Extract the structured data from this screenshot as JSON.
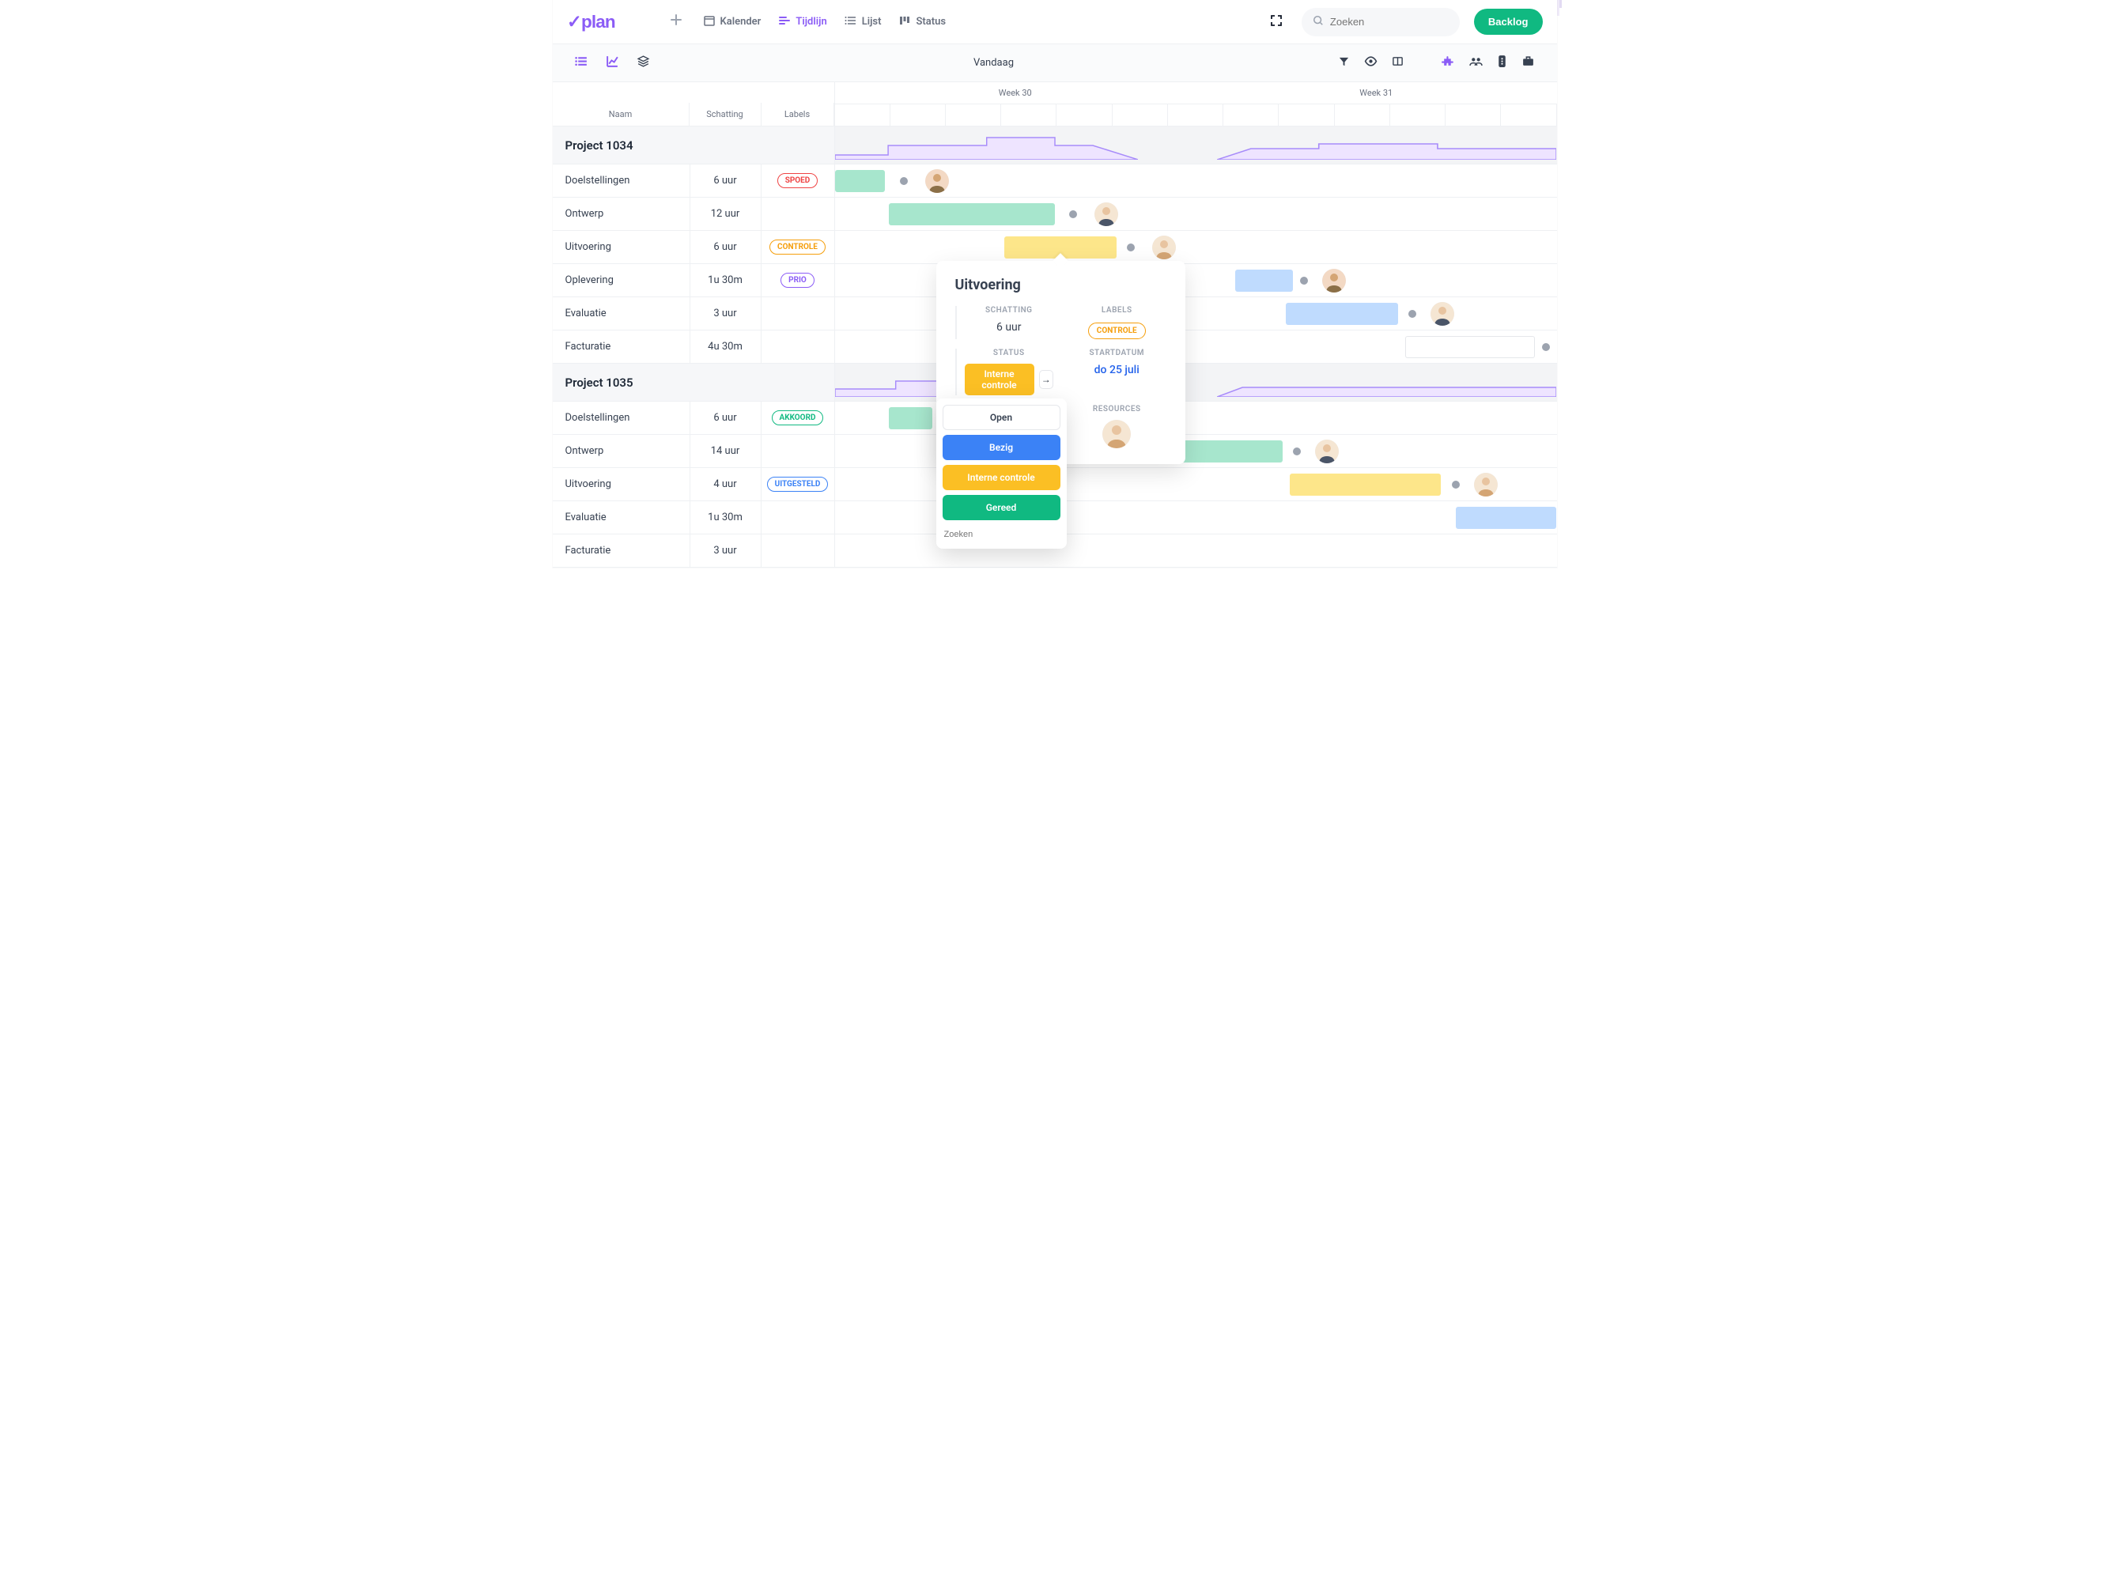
{
  "brand": "vplan",
  "nav": {
    "kalender": "Kalender",
    "tijdlijn": "Tijdlijn",
    "lijst": "Lijst",
    "status": "Status"
  },
  "search": {
    "placeholder": "Zoeken"
  },
  "backlog_btn": "Backlog",
  "toolbar_center": "Vandaag",
  "columns": {
    "naam": "Naam",
    "schatting": "Schatting",
    "labels": "Labels"
  },
  "weeks": {
    "w30": "Week 30",
    "w31": "Week 31"
  },
  "groups": [
    {
      "name": "Project 1034",
      "tasks": [
        {
          "name": "Doelstellingen",
          "est": "6 uur",
          "label": "SPOED",
          "label_class": "pill-spoed"
        },
        {
          "name": "Ontwerp",
          "est": "12 uur",
          "label": "",
          "label_class": ""
        },
        {
          "name": "Uitvoering",
          "est": "6 uur",
          "label": "CONTROLE",
          "label_class": "pill-controle"
        },
        {
          "name": "Oplevering",
          "est": "1u 30m",
          "label": "PRIO",
          "label_class": "pill-prio"
        },
        {
          "name": "Evaluatie",
          "est": "3 uur",
          "label": "",
          "label_class": ""
        },
        {
          "name": "Facturatie",
          "est": "4u 30m",
          "label": "",
          "label_class": ""
        }
      ]
    },
    {
      "name": "Project 1035",
      "tasks": [
        {
          "name": "Doelstellingen",
          "est": "6 uur",
          "label": "AKKOORD",
          "label_class": "pill-akkoord"
        },
        {
          "name": "Ontwerp",
          "est": "14 uur",
          "label": "",
          "label_class": ""
        },
        {
          "name": "Uitvoering",
          "est": "4 uur",
          "label": "UITGESTELD",
          "label_class": "pill-uitgesteld"
        },
        {
          "name": "Evaluatie",
          "est": "1u 30m",
          "label": "",
          "label_class": ""
        },
        {
          "name": "Facturatie",
          "est": "3 uur",
          "label": "",
          "label_class": ""
        }
      ]
    }
  ],
  "popover": {
    "title": "Uitvoering",
    "schatting_label": "SCHATTING",
    "schatting_val": "6 uur",
    "labels_label": "LABELS",
    "labels_val": "CONTROLE",
    "status_label": "STATUS",
    "status_val": "Interne controle",
    "startdatum_label": "STARTDATUM",
    "startdatum_val": "do 25 juli",
    "resources_label": "RESOURCES"
  },
  "status_dropdown": {
    "open": "Open",
    "bezig": "Bezig",
    "interne": "Interne controle",
    "gereed": "Gereed",
    "search_placeholder": "Zoeken"
  }
}
